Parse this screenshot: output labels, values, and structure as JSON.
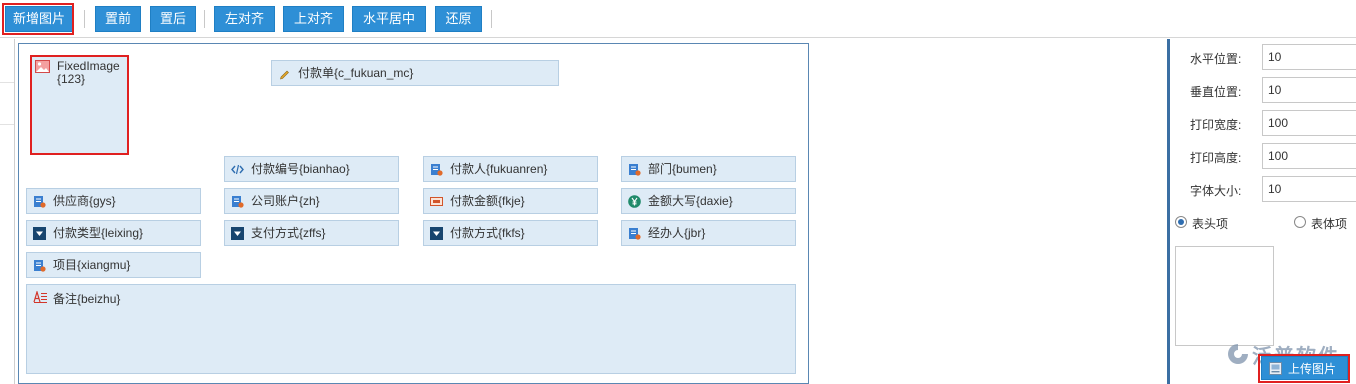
{
  "toolbar": {
    "add_image": "新增图片",
    "bring_front": "置前",
    "send_back": "置后",
    "align_left": "左对齐",
    "align_top": "上对齐",
    "center_horizontal": "水平居中",
    "restore": "还原"
  },
  "canvas": {
    "image_field": "FixedImage{123}",
    "title_field": "付款单{c_fukuan_mc}",
    "fields": [
      {
        "label": "付款编号{bianhao}",
        "icon": "code-icon"
      },
      {
        "label": "付款人{fukuanren}",
        "icon": "user-doc-icon"
      },
      {
        "label": "部门{bumen}",
        "icon": "user-doc-icon"
      },
      {
        "label": "供应商{gys}",
        "icon": "user-doc-icon"
      },
      {
        "label": "公司账户{zh}",
        "icon": "user-doc-icon"
      },
      {
        "label": "付款金额{fkje}",
        "icon": "money-icon"
      },
      {
        "label": "金额大写{daxie}",
        "icon": "yuan-icon"
      },
      {
        "label": "付款类型{leixing}",
        "icon": "dropdown-icon"
      },
      {
        "label": "支付方式{zffs}",
        "icon": "dropdown-icon"
      },
      {
        "label": "付款方式{fkfs}",
        "icon": "dropdown-icon"
      },
      {
        "label": "经办人{jbr}",
        "icon": "user-doc-icon"
      },
      {
        "label": "项目{xiangmu}",
        "icon": "user-doc-icon"
      }
    ],
    "remark_field": "备注{beizhu}"
  },
  "properties": {
    "h_pos_label": "水平位置:",
    "h_pos_value": "10",
    "v_pos_label": "垂直位置:",
    "v_pos_value": "10",
    "width_label": "打印宽度:",
    "width_value": "100",
    "height_label": "打印高度:",
    "height_value": "100",
    "font_label": "字体大小:",
    "font_value": "10",
    "radio_header": "表头项",
    "radio_body": "表体项",
    "upload_label": "上传图片"
  },
  "watermark": "泛普软件",
  "colors": {
    "accent": "#2e8fd6",
    "field_bg": "#deebf6",
    "highlight": "#e02020"
  }
}
